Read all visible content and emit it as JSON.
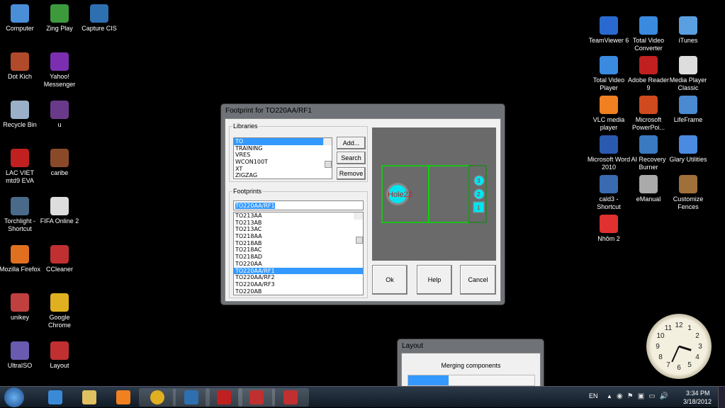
{
  "desktop_left": [
    {
      "label": "Computer",
      "color": "#4a8ed8"
    },
    {
      "label": "Zing Play",
      "color": "#3c9a3c"
    },
    {
      "label": "Capture CIS",
      "color": "#2e6fb0"
    },
    {
      "label": "Dot Kich",
      "color": "#b04a2a"
    },
    {
      "label": "Yahoo! Messenger",
      "color": "#7b2fb0"
    },
    {
      "label": "Recycle Bin",
      "color": "#9ab0c8"
    },
    {
      "label": "u",
      "color": "#6a3a8a"
    },
    {
      "label": "LAC VIET mtd9 EVA",
      "color": "#c02020"
    },
    {
      "label": "caribe",
      "color": "#8a4a2a"
    },
    {
      "label": "Torchlight - Shortcut",
      "color": "#4a6a8a"
    },
    {
      "label": "FIFA Online 2",
      "color": "#ddd"
    },
    {
      "label": "Mozilla Firefox",
      "color": "#e07020"
    },
    {
      "label": "CCleaner",
      "color": "#c03030"
    },
    {
      "label": "unikey",
      "color": "#c04040"
    },
    {
      "label": "Google Chrome",
      "color": "#e0b020"
    },
    {
      "label": "UltraISO",
      "color": "#6a5ab0"
    },
    {
      "label": "Layout",
      "color": "#c03030"
    }
  ],
  "desktop_right": [
    {
      "label": "TeamViewer 6",
      "color": "#2a6ad0"
    },
    {
      "label": "Total Video Converter",
      "color": "#3a8ae0"
    },
    {
      "label": "iTunes",
      "color": "#5aa0e0"
    },
    {
      "label": "Total Video Player",
      "color": "#3a8ae0"
    },
    {
      "label": "Adobe Reader 9",
      "color": "#c02020"
    },
    {
      "label": "Media Player Classic",
      "color": "#ddd"
    },
    {
      "label": "VLC media player",
      "color": "#f08020"
    },
    {
      "label": "Microsoft PowerPoi...",
      "color": "#d04a20"
    },
    {
      "label": "LifeFrame",
      "color": "#4a8ad0"
    },
    {
      "label": "Microsoft Word 2010",
      "color": "#2a5ab0"
    },
    {
      "label": "AI Recovery Burner",
      "color": "#3a7ac0"
    },
    {
      "label": "Glary Utilities",
      "color": "#4a8ae0"
    },
    {
      "label": "cald3 - Shortcut",
      "color": "#3a6ab0"
    },
    {
      "label": "eManual",
      "color": "#aaa"
    },
    {
      "label": "Customize Fences",
      "color": "#a0703a"
    },
    {
      "label": "Nhôm 2",
      "color": "#e03030"
    }
  ],
  "dialog": {
    "title": "Footprint for TO220AA/RF1",
    "libraries_label": "Libraries",
    "libraries": [
      "TO",
      "TRAINING",
      "VRES",
      "WCON100T",
      "XT",
      "ZIGZAG"
    ],
    "libraries_selected": 0,
    "add_label": "Add...",
    "search_label": "Search",
    "remove_label": "Remove",
    "footprints_label": "Footprints",
    "footprint_input": "TO220AA/RF1",
    "footprints": [
      "TO213AA",
      "TO213AB",
      "TO213AC",
      "TO218AA",
      "TO218AB",
      "TO218AC",
      "TO218AD",
      "TO220AA",
      "TO220AA/RF1",
      "TO220AA/RF2",
      "TO220AA/RF3",
      "TO220AB"
    ],
    "footprints_selected": 8,
    "preview": {
      "hole_label": "Hole22",
      "pins": [
        "3",
        "2",
        "1"
      ]
    },
    "ok_label": "Ok",
    "help_label": "Help",
    "cancel_label": "Cancel"
  },
  "layout_window": {
    "title": "Layout",
    "message": "Merging components",
    "progress_percent": 32
  },
  "tray": {
    "lang": "EN",
    "time": "3:34 PM",
    "date": "3/18/2012"
  },
  "clock_numbers": [
    "12",
    "1",
    "2",
    "3",
    "4",
    "5",
    "6",
    "7",
    "8",
    "9",
    "10",
    "11"
  ]
}
